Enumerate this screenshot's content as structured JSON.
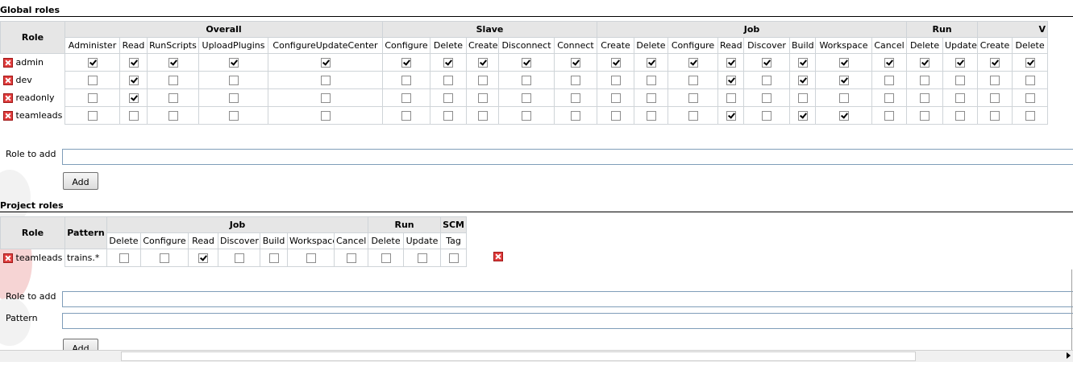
{
  "global": {
    "title": "Global roles",
    "role_header": "Role",
    "groups": [
      {
        "label": "Overall",
        "perms": [
          "Administer",
          "Read",
          "RunScripts",
          "UploadPlugins",
          "ConfigureUpdateCenter"
        ]
      },
      {
        "label": "Slave",
        "perms": [
          "Configure",
          "Delete",
          "Create",
          "Disconnect",
          "Connect"
        ]
      },
      {
        "label": "Job",
        "perms": [
          "Create",
          "Delete",
          "Configure",
          "Read",
          "Discover",
          "Build",
          "Workspace",
          "Cancel"
        ]
      },
      {
        "label": "Run",
        "perms": [
          "Delete",
          "Update"
        ]
      },
      {
        "label": "V",
        "perms": [
          "Create",
          "Delete"
        ]
      }
    ],
    "roles": [
      {
        "name": "admin",
        "checks": [
          1,
          1,
          1,
          1,
          1,
          1,
          1,
          1,
          1,
          1,
          1,
          1,
          1,
          1,
          1,
          1,
          1,
          1,
          1,
          1,
          1,
          1
        ]
      },
      {
        "name": "dev",
        "checks": [
          0,
          1,
          0,
          0,
          0,
          0,
          0,
          0,
          0,
          0,
          0,
          0,
          0,
          1,
          0,
          1,
          1,
          0,
          0,
          0,
          0,
          0
        ]
      },
      {
        "name": "readonly",
        "checks": [
          0,
          1,
          0,
          0,
          0,
          0,
          0,
          0,
          0,
          0,
          0,
          0,
          0,
          0,
          0,
          0,
          0,
          0,
          0,
          0,
          0,
          0
        ]
      },
      {
        "name": "teamleads",
        "checks": [
          0,
          0,
          0,
          0,
          0,
          0,
          0,
          0,
          0,
          0,
          0,
          0,
          0,
          1,
          0,
          1,
          1,
          0,
          0,
          0,
          0,
          0
        ]
      }
    ],
    "role_to_add_label": "Role to add",
    "role_to_add_value": "",
    "add_button": "Add"
  },
  "project": {
    "title": "Project roles",
    "role_header": "Role",
    "pattern_header": "Pattern",
    "groups": [
      {
        "label": "Job",
        "perms": [
          "Delete",
          "Configure",
          "Read",
          "Discover",
          "Build",
          "Workspace",
          "Cancel"
        ]
      },
      {
        "label": "Run",
        "perms": [
          "Delete",
          "Update"
        ]
      },
      {
        "label": "SCM",
        "perms": [
          "Tag"
        ]
      }
    ],
    "roles": [
      {
        "name": "teamleads",
        "pattern": "trains.*",
        "checks": [
          0,
          0,
          1,
          0,
          0,
          0,
          0,
          0,
          0,
          0
        ]
      }
    ],
    "role_to_add_label": "Role to add",
    "role_to_add_value": "",
    "pattern_label": "Pattern",
    "pattern_value": "",
    "add_button": "Add"
  },
  "colors": {
    "header_bg": "#e6e6e6",
    "cell_border": "#cfd4d8",
    "delete_icon": "#e03c3c"
  }
}
